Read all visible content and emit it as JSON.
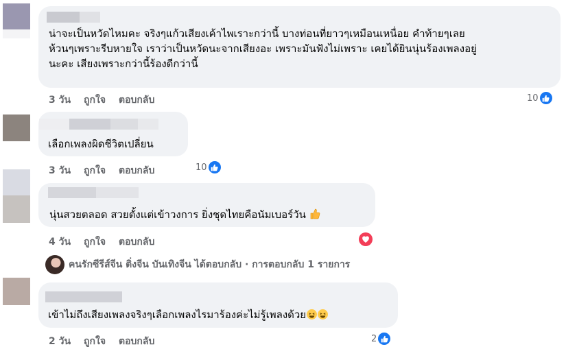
{
  "comments": [
    {
      "text": "น่าจะเป็นหวัดไหมคะ จริงๆแก้วเสียงเค้าไพเราะกว่านี้ บางท่อนที่ยาวๆเหมือนเหนื่อย คำท้ายๆเลย\nห้วนๆเพราะรีบหายใจ เราว่าเป็นหวัดนะจากเสียงอะ เพราะมันฟังไม่เพราะ เคยได้ยินนุ่นร้องเพลงอยู่\nนะคะ เสียงเพราะกว่านี้ร้องดีกว่านี้",
      "time": "3 วัน",
      "like": "ถูกใจ",
      "reply": "ตอบกลับ",
      "reaction_count": "10"
    },
    {
      "text": "เลือกเพลงผิดชีวิตเปลี่ยน",
      "time": "3 วัน",
      "like": "ถูกใจ",
      "reply": "ตอบกลับ",
      "reaction_count": "10"
    },
    {
      "text": "นุ่นสวยตลอด สวยตั้งแต่เข้าวงการ ยิ่งชุดไทยคือนัมเบอร์วัน",
      "time": "4 วัน",
      "like": "ถูกใจ",
      "reply": "ตอบกลับ"
    },
    {
      "text": "เข้าไม่ถึงเสียงเพลงจริงๆเลือกเพลงไรมาร้องค่ะไม่รู้เพลงด้วย",
      "time": "2 วัน",
      "like": "ถูกใจ",
      "reply": "ตอบกลับ",
      "reaction_count": "2"
    }
  ],
  "reply_summary": "คนรักซีรีส์จีน ติ่งจีน บันเทิงจีน ได้ตอบกลับ · การตอบกลับ 1 รายการ",
  "colors": {
    "bubble": "#f0f2f5",
    "like_blue": "#1877f2",
    "love_red": "#f33e58",
    "meta_gray": "#65676b"
  },
  "icons": [
    "like-icon",
    "love-icon",
    "thumbs-up-emoji",
    "laughing-emoji"
  ]
}
